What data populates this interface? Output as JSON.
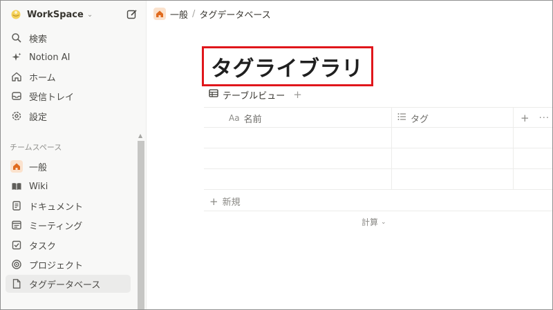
{
  "workspace": {
    "name": "WorkSpace"
  },
  "sidebar": {
    "top_items": [
      {
        "label": "検索",
        "icon": "search-icon"
      },
      {
        "label": "Notion AI",
        "icon": "sparkle-icon"
      },
      {
        "label": "ホーム",
        "icon": "home-icon"
      },
      {
        "label": "受信トレイ",
        "icon": "inbox-icon"
      },
      {
        "label": "設定",
        "icon": "gear-icon"
      }
    ],
    "section_label": "チームスペース",
    "team_items": [
      {
        "label": "一般",
        "icon": "house-badge-icon"
      },
      {
        "label": "Wiki",
        "icon": "book-icon"
      },
      {
        "label": "ドキュメント",
        "icon": "document-icon"
      },
      {
        "label": "ミーティング",
        "icon": "meeting-icon"
      },
      {
        "label": "タスク",
        "icon": "checkbox-icon"
      },
      {
        "label": "プロジェクト",
        "icon": "target-icon"
      },
      {
        "label": "タグデータベース",
        "icon": "page-icon",
        "active": true
      }
    ]
  },
  "breadcrumb": {
    "parent": "一般",
    "separator": "/",
    "current": "タグデータベース"
  },
  "page": {
    "title": "タグライブラリ",
    "view_label": "テーブルビュー",
    "columns": [
      {
        "prefix": "Aa",
        "label": "名前"
      },
      {
        "label": "タグ"
      }
    ],
    "new_label": "新規",
    "calc_label": "計算"
  },
  "colors": {
    "highlight": "#e0161b",
    "home_badge": "#fbe2cd",
    "home_icon": "#e06b1f"
  }
}
